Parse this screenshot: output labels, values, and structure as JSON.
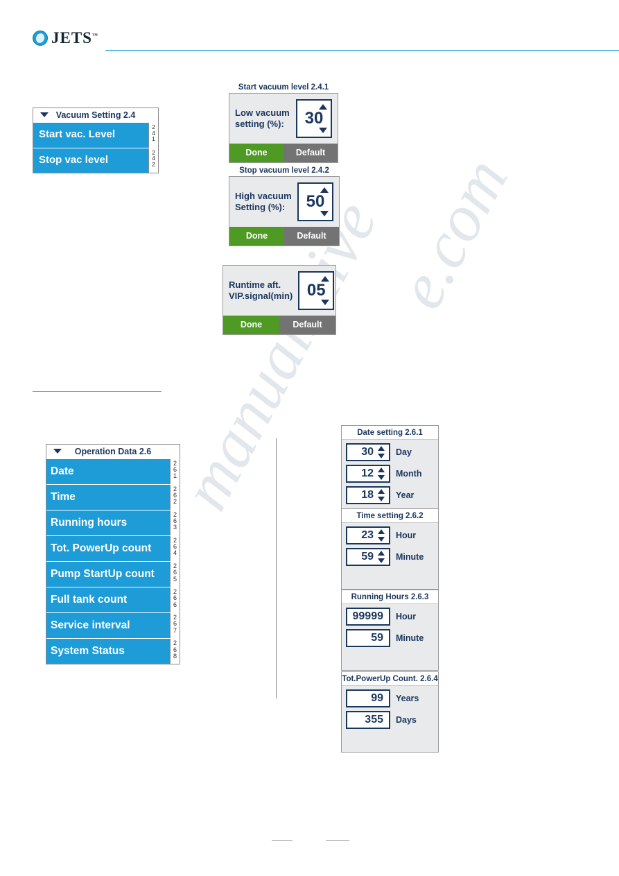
{
  "brand": {
    "name": "JETS",
    "tm": "™",
    "logo_icon": "jets-droplet-logo",
    "accent": "#1a9ed4"
  },
  "watermark": {
    "line1": "e.com",
    "line2": "manualshive"
  },
  "vacuum_menu": {
    "title": "Vacuum Setting 2.4",
    "caret_icon": "triangle-down-icon",
    "rows": [
      {
        "label": "Start vac. Level",
        "code": [
          "2",
          "4",
          "1"
        ]
      },
      {
        "label": "Stop vac level",
        "code": [
          "2",
          "4",
          "2"
        ]
      }
    ]
  },
  "dialogs": [
    {
      "caption": "Start vacuum level 2.4.1",
      "label": "Low vacuum setting  (%):",
      "value": "30",
      "up_icon": "triangle-up-icon",
      "down_icon": "triangle-down-icon",
      "done_label": "Done",
      "default_label": "Default",
      "done_color": "#4e9a24",
      "default_color": "#737373"
    },
    {
      "caption": "Stop vacuum level 2.4.2",
      "label": "High  vacuum Setting (%):",
      "value": "50",
      "up_icon": "triangle-up-icon",
      "down_icon": "triangle-down-icon",
      "done_label": "Done",
      "default_label": "Default",
      "done_color": "#4e9a24",
      "default_color": "#737373"
    },
    {
      "caption": "",
      "label": "Runtime aft. VIP.signal(min)",
      "value": "05",
      "up_icon": "triangle-up-icon",
      "down_icon": "triangle-down-icon",
      "done_label": "Done",
      "default_label": "Default",
      "done_color": "#4e9a24",
      "default_color": "#737373"
    }
  ],
  "operation_menu": {
    "title": "Operation Data 2.6",
    "caret_icon": "triangle-down-icon",
    "rows": [
      {
        "label": "Date",
        "code": [
          "2",
          "6",
          "1"
        ]
      },
      {
        "label": "Time",
        "code": [
          "2",
          "6",
          "2"
        ]
      },
      {
        "label": "Running hours",
        "code": [
          "2",
          "6",
          "3"
        ]
      },
      {
        "label": "Tot. PowerUp count",
        "code": [
          "2",
          "6",
          "4"
        ]
      },
      {
        "label": "Pump StartUp count",
        "code": [
          "2",
          "6",
          "5"
        ]
      },
      {
        "label": "Full tank count",
        "code": [
          "2",
          "6",
          "6"
        ]
      },
      {
        "label": "Service interval",
        "code": [
          "2",
          "6",
          "7"
        ]
      },
      {
        "label": "System Status",
        "code": [
          "2",
          "6",
          "8"
        ]
      }
    ]
  },
  "small_dialogs": [
    {
      "caption": "Date setting 2.6.1",
      "fields": [
        {
          "value": "30",
          "unit": "Day",
          "arrows": true
        },
        {
          "value": "12",
          "unit": "Month",
          "arrows": true
        },
        {
          "value": "18",
          "unit": "Year",
          "arrows": true
        }
      ]
    },
    {
      "caption": "Time setting 2.6.2",
      "fields": [
        {
          "value": "23",
          "unit": "Hour",
          "arrows": true
        },
        {
          "value": "59",
          "unit": "Minute",
          "arrows": true
        }
      ]
    },
    {
      "caption": "Running Hours 2.6.3",
      "fields": [
        {
          "value": "99999",
          "unit": "Hour",
          "arrows": false
        },
        {
          "value": "59",
          "unit": "Minute",
          "arrows": false
        }
      ]
    },
    {
      "caption": "Tot.PowerUp Count. 2.6.4",
      "fields": [
        {
          "value": "99",
          "unit": "Years",
          "arrows": false
        },
        {
          "value": "355",
          "unit": "Days",
          "arrows": false
        }
      ]
    }
  ]
}
